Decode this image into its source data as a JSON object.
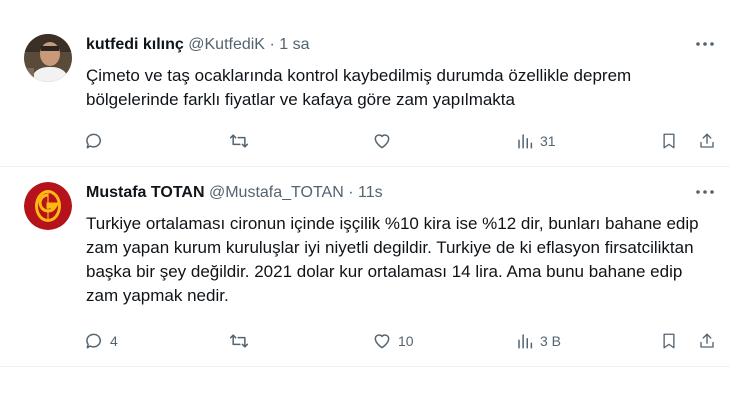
{
  "colors": {
    "text": "#0f1419",
    "secondary": "#536471",
    "divider": "#eff3f4",
    "gs_red": "#b5121b",
    "gs_yellow": "#fdb912"
  },
  "tweets": [
    {
      "name": "kutfedi kılınç",
      "handle": "@KutfediK",
      "separator": "·",
      "time": "1 sa",
      "text": "Çimeto ve taş ocaklarında kontrol kaybedilmiş durumda özellikle deprem bölgelerinde farklı fiyatlar ve kafaya göre zam yapılmakta",
      "reply_count": "",
      "retweet_count": "",
      "like_count": "",
      "view_count": "31",
      "more_icon": "more-icon",
      "avatar": "avatar-photo"
    },
    {
      "name": "Mustafa TOTAN",
      "handle": "@Mustafa_TOTAN",
      "separator": "·",
      "time": "11s",
      "text": "Turkiye ortalaması cironun içinde işçilik %10 kira ise %12 dir, bunları bahane edip zam yapan kurum kuruluşlar iyi niyetli degildir. Turkiye de ki eflasyon firsatciliktan başka bir şey değildir. 2021 dolar kur ortalaması 14 lira. Ama bunu bahane edip zam yapmak nedir.",
      "reply_count": "4",
      "retweet_count": "",
      "like_count": "10",
      "view_count": "3 B",
      "more_icon": "more-icon",
      "avatar": "galatasaray-logo"
    }
  ]
}
